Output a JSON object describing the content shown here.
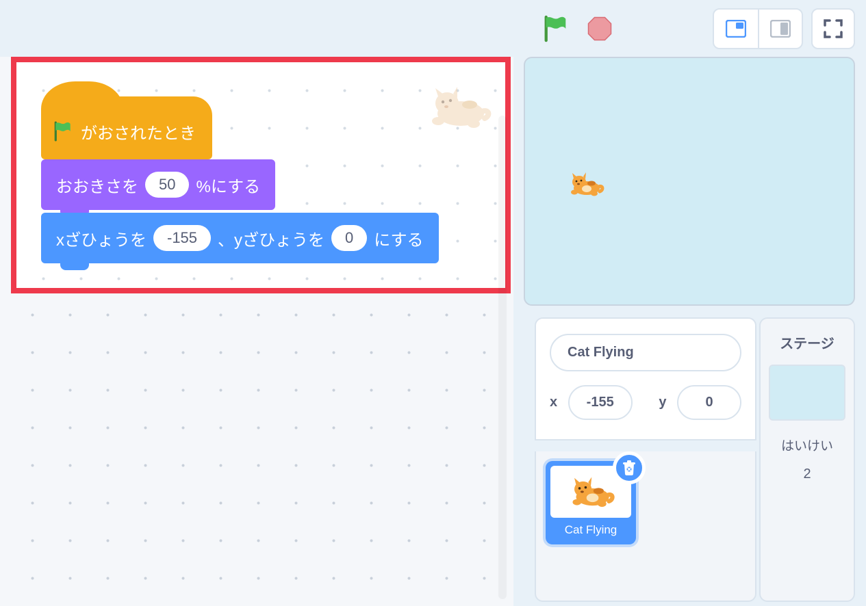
{
  "toolbar": {
    "flag_icon": "green-flag",
    "stop_icon": "stop-sign"
  },
  "blocks": {
    "hat": {
      "label": "がおされたとき"
    },
    "size": {
      "prefix": "おおきさを",
      "value": "50",
      "suffix": "%にする"
    },
    "goto": {
      "x_prefix": "xざひょうを",
      "x_value": "-155",
      "mid": "、yざひょうを",
      "y_value": "0",
      "suffix": "にする"
    }
  },
  "sprite_info": {
    "name": "Cat Flying",
    "x_label": "x",
    "x_value": "-155",
    "y_label": "y",
    "y_value": "0"
  },
  "sprite_tile": {
    "label": "Cat Flying"
  },
  "stage_selector": {
    "title": "ステージ",
    "backdrop_label": "はいけい",
    "backdrop_count": "2"
  }
}
